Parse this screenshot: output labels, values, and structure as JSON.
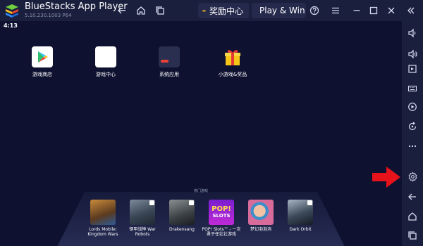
{
  "window": {
    "title": "BlueStacks App Player",
    "version": "5.10.230.1003  P64"
  },
  "titlebar": {
    "rewards_label": "奖励中心",
    "play_win_label": "Play & Win",
    "icons": [
      "back-icon",
      "home-icon",
      "recent-apps-icon",
      "crown-icon",
      "bluestacks-x-icon",
      "help-icon",
      "menu-icon",
      "minimize-icon",
      "maximize-icon",
      "close-icon",
      "collapse-sidebar-icon"
    ]
  },
  "status_bar": {
    "time": "4:13"
  },
  "home_apps": [
    {
      "label": "游戏商店",
      "icon": "play-store-icon"
    },
    {
      "label": "游戏中心",
      "icon": "game-center-icon"
    },
    {
      "label": "系统应用",
      "icon": "system-apps-icon"
    },
    {
      "label": "小游戏&奖品",
      "icon": "gift-icon"
    }
  ],
  "dock": {
    "title": "热门游戏",
    "apps": [
      {
        "label": "Lords Mobile: Kingdom Wars"
      },
      {
        "label": "钢甲战神 War Robots"
      },
      {
        "label": "Drakensang"
      },
      {
        "label": "POP! Slots™ - 一次 勇于任壮壮游戏"
      },
      {
        "label": "梦幻泡泡消"
      },
      {
        "label": "Dark Orbit"
      }
    ],
    "pop_tile_text": [
      "POP!",
      "SLOTS"
    ]
  },
  "sidebar": {
    "icons": [
      "volume-icon",
      "screenshot-icon",
      "keyboard-icon",
      "record-icon",
      "rotate-icon",
      "more-icon",
      "settings-icon",
      "back-icon",
      "home-icon",
      "recent-apps-icon"
    ]
  },
  "colors": {
    "titlebar": "#1a1f3d",
    "screen": "#0e1230",
    "annotation_arrow": "#e8121b"
  }
}
